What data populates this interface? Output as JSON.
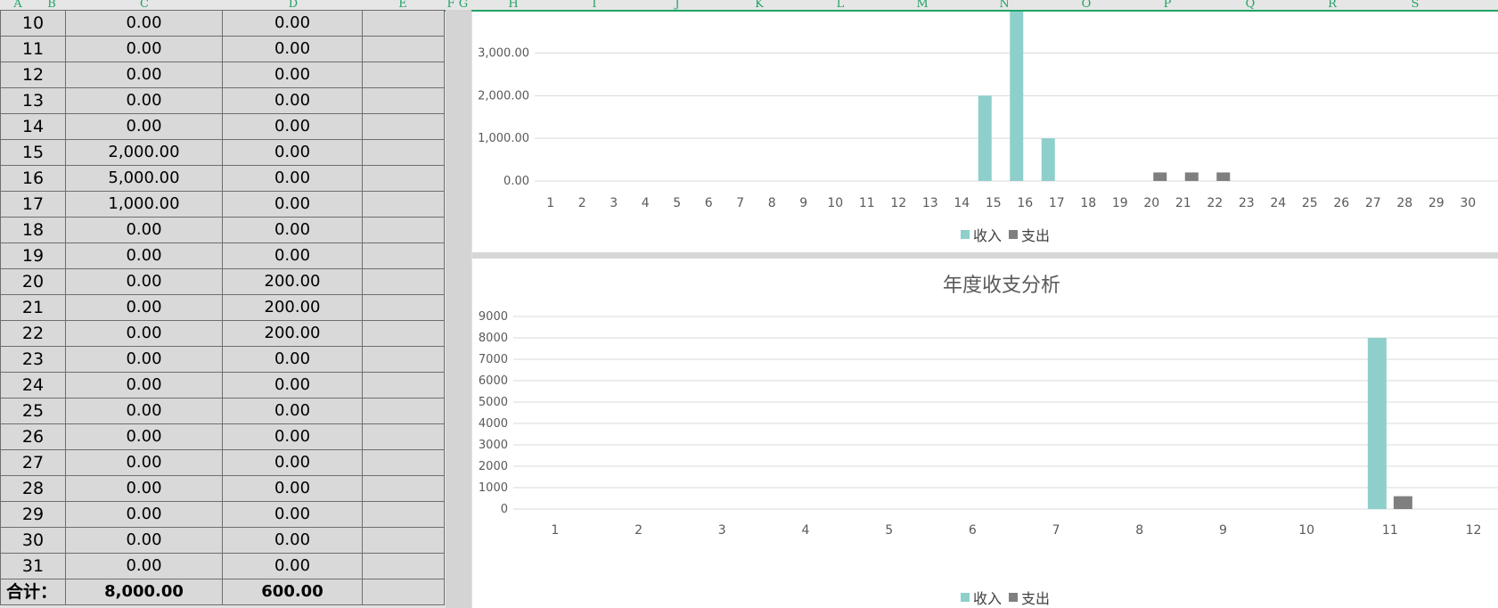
{
  "column_headers": [
    "A",
    "B",
    "C",
    "D",
    "E",
    "F",
    "G",
    "H",
    "I",
    "J",
    "K",
    "L",
    "M",
    "N",
    "O",
    "P",
    "Q",
    "R",
    "S"
  ],
  "sheet": {
    "rows": [
      {
        "day": "10",
        "income": "0.00",
        "expense": "0.00"
      },
      {
        "day": "11",
        "income": "0.00",
        "expense": "0.00"
      },
      {
        "day": "12",
        "income": "0.00",
        "expense": "0.00"
      },
      {
        "day": "13",
        "income": "0.00",
        "expense": "0.00"
      },
      {
        "day": "14",
        "income": "0.00",
        "expense": "0.00"
      },
      {
        "day": "15",
        "income": "2,000.00",
        "expense": "0.00"
      },
      {
        "day": "16",
        "income": "5,000.00",
        "expense": "0.00"
      },
      {
        "day": "17",
        "income": "1,000.00",
        "expense": "0.00"
      },
      {
        "day": "18",
        "income": "0.00",
        "expense": "0.00"
      },
      {
        "day": "19",
        "income": "0.00",
        "expense": "0.00"
      },
      {
        "day": "20",
        "income": "0.00",
        "expense": "200.00"
      },
      {
        "day": "21",
        "income": "0.00",
        "expense": "200.00"
      },
      {
        "day": "22",
        "income": "0.00",
        "expense": "200.00"
      },
      {
        "day": "23",
        "income": "0.00",
        "expense": "0.00"
      },
      {
        "day": "24",
        "income": "0.00",
        "expense": "0.00"
      },
      {
        "day": "25",
        "income": "0.00",
        "expense": "0.00"
      },
      {
        "day": "26",
        "income": "0.00",
        "expense": "0.00"
      },
      {
        "day": "27",
        "income": "0.00",
        "expense": "0.00"
      },
      {
        "day": "28",
        "income": "0.00",
        "expense": "0.00"
      },
      {
        "day": "29",
        "income": "0.00",
        "expense": "0.00"
      },
      {
        "day": "30",
        "income": "0.00",
        "expense": "0.00"
      },
      {
        "day": "31",
        "income": "0.00",
        "expense": "0.00"
      }
    ],
    "total": {
      "label": "合计：",
      "income": "8,000.00",
      "expense": "600.00"
    }
  },
  "colors": {
    "income": "#8ecfcb",
    "expense": "#7f7f7f",
    "grid": "#d9d9d9",
    "axis_text": "#595959",
    "header_accent": "#21a366"
  },
  "chart_data": [
    {
      "type": "bar",
      "title": "",
      "categories": [
        "1",
        "2",
        "3",
        "4",
        "5",
        "6",
        "7",
        "8",
        "9",
        "10",
        "11",
        "12",
        "13",
        "14",
        "15",
        "16",
        "17",
        "18",
        "19",
        "20",
        "21",
        "22",
        "23",
        "24",
        "25",
        "26",
        "27",
        "28",
        "29",
        "30"
      ],
      "y_ticks": [
        "0.00",
        "1,000.00",
        "2,000.00",
        "3,000.00"
      ],
      "ylim": [
        0,
        3700
      ],
      "series": [
        {
          "name": "收入",
          "values": [
            0,
            0,
            0,
            0,
            0,
            0,
            0,
            0,
            0,
            0,
            0,
            0,
            0,
            0,
            2000,
            5000,
            1000,
            0,
            0,
            0,
            0,
            0,
            0,
            0,
            0,
            0,
            0,
            0,
            0,
            0
          ]
        },
        {
          "name": "支出",
          "values": [
            0,
            0,
            0,
            0,
            0,
            0,
            0,
            0,
            0,
            0,
            0,
            0,
            0,
            0,
            0,
            0,
            0,
            0,
            0,
            200,
            200,
            200,
            0,
            0,
            0,
            0,
            0,
            0,
            0,
            0
          ]
        }
      ],
      "legend": [
        "收入",
        "支出"
      ],
      "legend_position": "bottom",
      "grid": true
    },
    {
      "type": "bar",
      "title": "年度收支分析",
      "categories": [
        "1",
        "2",
        "3",
        "4",
        "5",
        "6",
        "7",
        "8",
        "9",
        "10",
        "11",
        "12"
      ],
      "y_ticks": [
        "0",
        "1000",
        "2000",
        "3000",
        "4000",
        "5000",
        "6000",
        "7000",
        "8000",
        "9000"
      ],
      "ylim": [
        0,
        9000
      ],
      "series": [
        {
          "name": "收入",
          "values": [
            0,
            0,
            0,
            0,
            0,
            0,
            0,
            0,
            0,
            0,
            8000,
            0
          ]
        },
        {
          "name": "支出",
          "values": [
            0,
            0,
            0,
            0,
            0,
            0,
            0,
            0,
            0,
            0,
            600,
            0
          ]
        }
      ],
      "legend": [
        "收入",
        "支出"
      ],
      "legend_position": "bottom",
      "grid": true
    }
  ]
}
